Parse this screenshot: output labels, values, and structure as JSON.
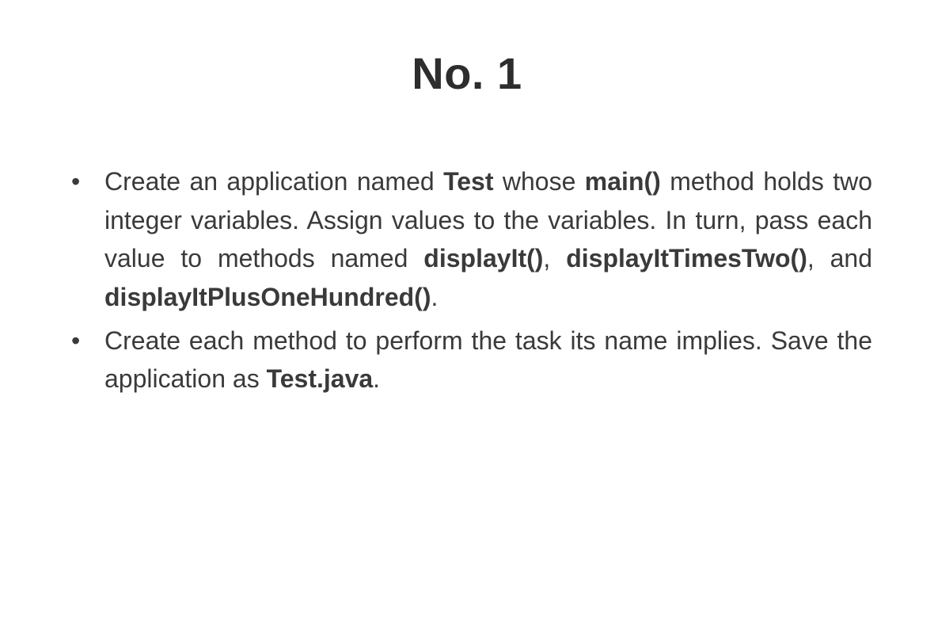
{
  "title": "No. 1",
  "bullets": [
    {
      "segments": [
        {
          "text": "Create an application named ",
          "bold": false
        },
        {
          "text": "Test",
          "bold": true
        },
        {
          "text": " whose ",
          "bold": false
        },
        {
          "text": "main()",
          "bold": true
        },
        {
          "text": " method holds two integer variables. Assign values to the variables. In turn, pass each value to methods named ",
          "bold": false
        },
        {
          "text": "displayIt()",
          "bold": true
        },
        {
          "text": ", ",
          "bold": false
        },
        {
          "text": "displayItTimesTwo()",
          "bold": true
        },
        {
          "text": ", and ",
          "bold": false
        },
        {
          "text": "displayItPlusOneHundred()",
          "bold": true
        },
        {
          "text": ".",
          "bold": false
        }
      ]
    },
    {
      "segments": [
        {
          "text": "Create each method to perform the task its name implies. Save the application as ",
          "bold": false
        },
        {
          "text": "Test.java",
          "bold": true
        },
        {
          "text": ".",
          "bold": false
        }
      ]
    }
  ]
}
